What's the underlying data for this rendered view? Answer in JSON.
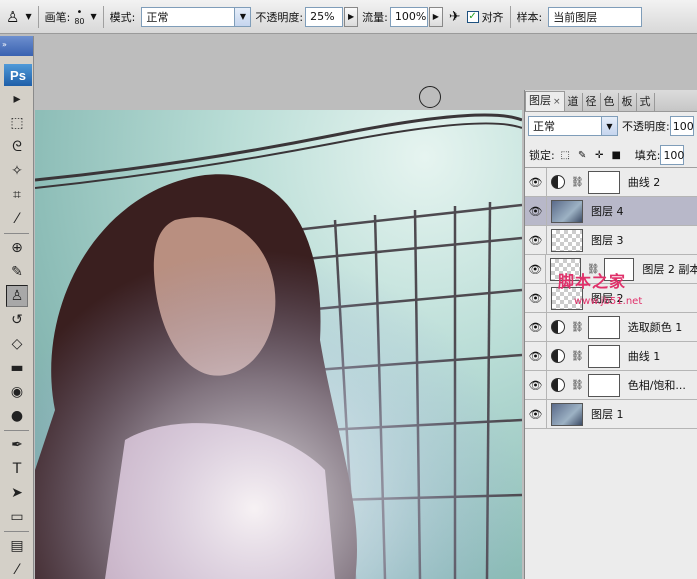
{
  "options_bar": {
    "brush_label": "画笔:",
    "brush_size": "80",
    "mode_label": "模式:",
    "mode_value": "正常",
    "opacity_label": "不透明度:",
    "opacity_value": "25%",
    "flow_label": "流量:",
    "flow_value": "100%",
    "align_label": "对齐",
    "sample_label": "样本:",
    "sample_value": "当前图层"
  },
  "toolbox": {
    "logo": "Ps",
    "grip": "»",
    "tools": [
      {
        "name": "move-tool",
        "glyph": "▸"
      },
      {
        "name": "marquee-tool",
        "glyph": "⬚"
      },
      {
        "name": "lasso-tool",
        "glyph": "ᘓ"
      },
      {
        "name": "magic-wand-tool",
        "glyph": "✧"
      },
      {
        "name": "crop-tool",
        "glyph": "⌗"
      },
      {
        "name": "eyedropper-slice-tool",
        "glyph": "⁄"
      },
      {
        "name": "healing-brush-tool",
        "glyph": "⊕"
      },
      {
        "name": "brush-tool",
        "glyph": "✎"
      },
      {
        "name": "clone-stamp-tool",
        "glyph": "♙"
      },
      {
        "name": "history-brush-tool",
        "glyph": "↺"
      },
      {
        "name": "eraser-tool",
        "glyph": "◇"
      },
      {
        "name": "gradient-tool",
        "glyph": "▬"
      },
      {
        "name": "blur-tool",
        "glyph": "◉"
      },
      {
        "name": "dodge-tool",
        "glyph": "●"
      },
      {
        "name": "pen-tool",
        "glyph": "✒"
      },
      {
        "name": "type-tool",
        "glyph": "T"
      },
      {
        "name": "path-selection-tool",
        "glyph": "➤"
      },
      {
        "name": "shape-tool",
        "glyph": "▭"
      },
      {
        "name": "notes-tool",
        "glyph": "▤"
      },
      {
        "name": "eyedropper-tool",
        "glyph": "⁄"
      },
      {
        "name": "hand-tool",
        "glyph": "✋"
      }
    ]
  },
  "panel": {
    "tabs": [
      {
        "label": "图层",
        "active": true
      },
      {
        "label": "道",
        "active": false
      },
      {
        "label": "径",
        "active": false
      },
      {
        "label": "色",
        "active": false
      },
      {
        "label": "板",
        "active": false
      },
      {
        "label": "式",
        "active": false
      }
    ],
    "blend_mode": "正常",
    "opacity_label": "不透明度:",
    "opacity_value": "100",
    "lock_label": "锁定:",
    "fill_label": "填充:",
    "fill_value": "100",
    "layers": [
      {
        "name": "曲线 2",
        "kind": "adjustment",
        "selected": false
      },
      {
        "name": "图层 4",
        "kind": "photo",
        "selected": true
      },
      {
        "name": "图层 3",
        "kind": "empty",
        "selected": false
      },
      {
        "name": "图层 2 副本",
        "kind": "masked",
        "selected": false
      },
      {
        "name": "图层 2",
        "kind": "empty",
        "selected": false
      },
      {
        "name": "选取颜色 1",
        "kind": "adjustment",
        "selected": false
      },
      {
        "name": "曲线 1",
        "kind": "adjustment",
        "selected": false
      },
      {
        "name": "色相/饱和...",
        "kind": "adjustment",
        "selected": false
      },
      {
        "name": "图层 1",
        "kind": "photo",
        "selected": false
      }
    ]
  },
  "watermark": {
    "text": "脚本之家",
    "url": "www.jb51.net"
  },
  "colors": {
    "panel_bg": "#ececec",
    "selected_layer": "#b8b8c9",
    "watermark": "#e0306a"
  }
}
